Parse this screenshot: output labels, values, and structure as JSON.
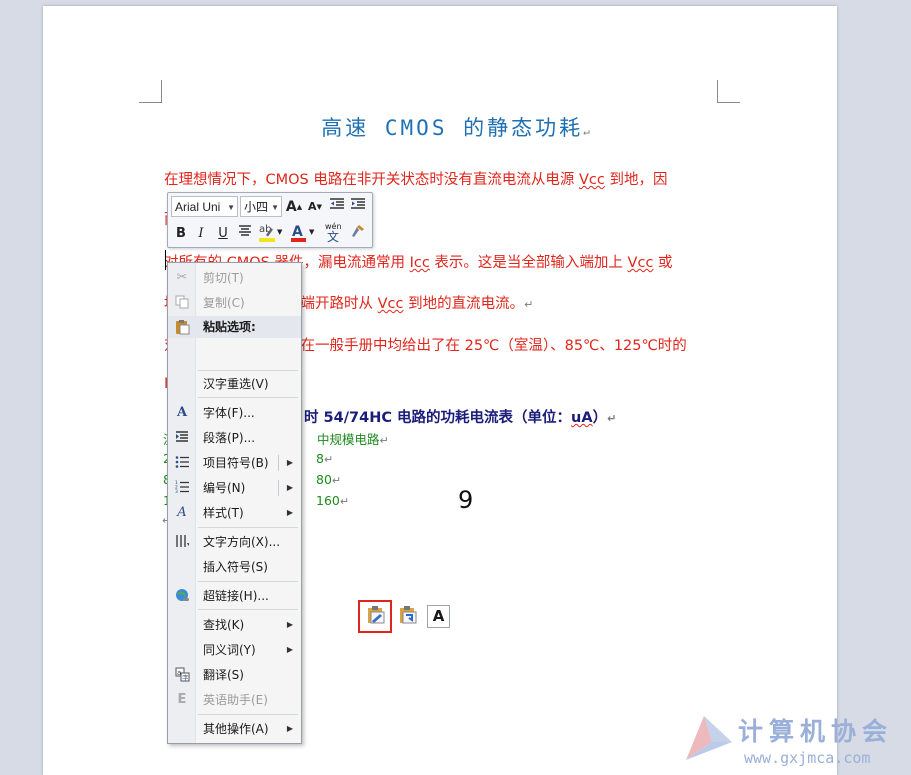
{
  "document": {
    "title": "高速 CMOS 的静态功耗",
    "paragraph_mark": "↵",
    "line1": {
      "a": "在理想情况下，CMOS 电路在非开关状态时没有直流电流从电源 ",
      "vcc": "Vcc",
      "b": " 到地，因"
    },
    "line1b": "而",
    "line2": {
      "a": "对所有的 CMOS 器件，漏电流通常用 ",
      "icc": "Icc",
      "b": " 表示。这是当全部输入端加上 ",
      "vcc": "Vcc",
      "c": " 或"
    },
    "line3": {
      "a": "地",
      "b": "端开路时从 ",
      "vcc": "Vcc",
      "c": " 到地的直流电流。"
    },
    "line4": {
      "a": "对",
      "b": "在一般手册中均给出了在 25℃（室温）、85℃、125℃时的"
    },
    "line5": "I",
    "table_title": {
      "a": "时 54/74HC 电路的功耗电流表（单位：",
      "b": "uA",
      "c": "）"
    },
    "col_header_left": "温",
    "col_header": "中规模电路",
    "rows_left": [
      "2",
      "8",
      "1"
    ],
    "rows": [
      "8",
      "80",
      "160"
    ],
    "page_number": "9",
    "end_mark": "↵"
  },
  "mini_toolbar": {
    "font_name": "Arial Uni",
    "font_size": "小四",
    "grow_font": "A",
    "shrink_font": "A",
    "bold": "B",
    "italic": "I",
    "underline": "U",
    "highlight_label": "ab",
    "font_color_label": "A",
    "phonetic_label": "wén"
  },
  "context_menu": {
    "cut": "剪切(T)",
    "copy": "复制(C)",
    "paste_header": "粘贴选项:",
    "paste_text_only": "A",
    "reconvert": "汉字重选(V)",
    "font": "字体(F)...",
    "paragraph": "段落(P)...",
    "bullets": "项目符号(B)",
    "numbering": "编号(N)",
    "styles": "样式(T)",
    "text_direction": "文字方向(X)...",
    "insert_symbol": "插入符号(S)",
    "hyperlink": "超链接(H)...",
    "find": "查找(K)",
    "synonyms": "同义词(Y)",
    "translate": "翻译(S)",
    "english_assistant": "英语助手(E)",
    "more_actions": "其他操作(A)"
  },
  "watermark": {
    "text": "计算机协会",
    "url": "www.gxjmca.com"
  },
  "colors": {
    "accent_red": "#e0261c",
    "title_blue": "#1f6fb2",
    "table_green": "#1f8a1f"
  }
}
